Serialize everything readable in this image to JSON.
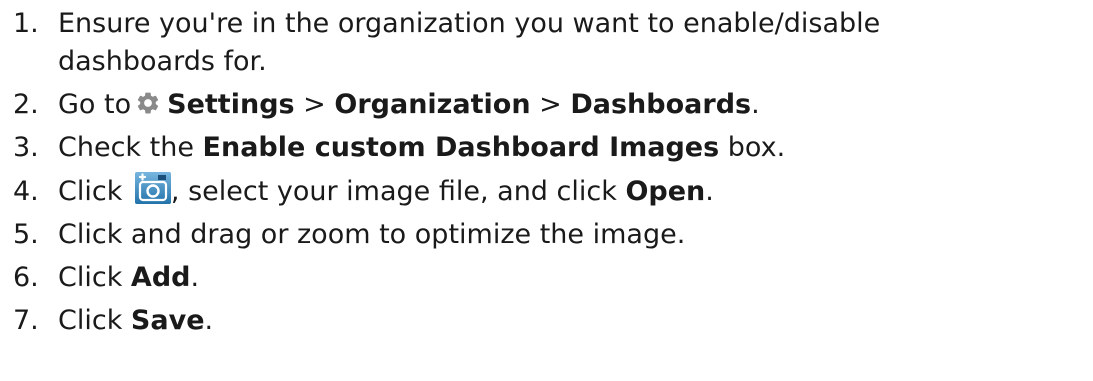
{
  "steps": [
    {
      "number": "1.",
      "line1": "Ensure you're in the organization you want to enable/disable",
      "line2": "dashboards for."
    },
    {
      "number": "2.",
      "go_to": "Go to",
      "settings": "Settings",
      "sep1": " > ",
      "organization": "Organization",
      "sep2": " > ",
      "dashboards": "Dashboards",
      "end": "."
    },
    {
      "number": "3.",
      "prefix": "Check the ",
      "bold": "Enable custom Dashboard Images",
      "suffix": " box."
    },
    {
      "number": "4.",
      "prefix": "Click ",
      "middle": ", select your image file, and click ",
      "bold": "Open",
      "suffix": "."
    },
    {
      "number": "5.",
      "text": "Click and drag or zoom to optimize the image."
    },
    {
      "number": "6.",
      "prefix": "Click ",
      "bold": "Add",
      "suffix": "."
    },
    {
      "number": "7.",
      "prefix": "Click ",
      "bold": "Save",
      "suffix": "."
    }
  ],
  "icons": {
    "settings": "gear-icon",
    "add_image": "add-image-camera-icon"
  },
  "colors": {
    "text": "#1a1a1a",
    "gear": "#8a8a8a",
    "camera_bg": "#2f8fcf"
  }
}
